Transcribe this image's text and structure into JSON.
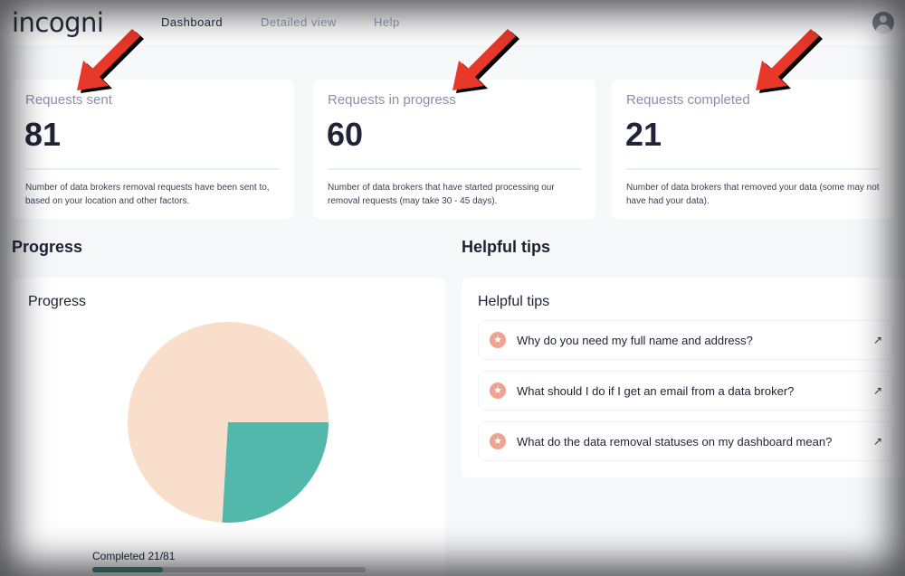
{
  "nav": {
    "logo": "incogni",
    "links": [
      "Dashboard",
      "Detailed view",
      "Help"
    ],
    "active": "Dashboard"
  },
  "stats": [
    {
      "title": "Requests sent",
      "value": "81",
      "desc": "Number of data brokers removal requests have been sent to, based on your location and other factors."
    },
    {
      "title": "Requests in progress",
      "value": "60",
      "desc": "Number of data brokers that have started processing our removal requests (may take 30 - 45 days)."
    },
    {
      "title": "Requests completed",
      "value": "21",
      "desc": "Number of data brokers that removed your data (some may not have had your data)."
    }
  ],
  "progress": {
    "heading": "Progress",
    "panel_title": "Progress",
    "completed_label": "Completed 21/81",
    "completed": 21,
    "total": 81,
    "colors": {
      "completed": "#52b8ac",
      "remaining": "#f9dfcb",
      "bar": "#3a8a7f"
    }
  },
  "tips": {
    "heading": "Helpful tips",
    "panel_title": "Helpful tips",
    "items": [
      "Why do you need my full name and address?",
      "What should I do if I get an email from a data broker?",
      "What do the data removal statuses on my dashboard mean?"
    ]
  },
  "annotations": {
    "arrow_color": "#e8382a"
  }
}
